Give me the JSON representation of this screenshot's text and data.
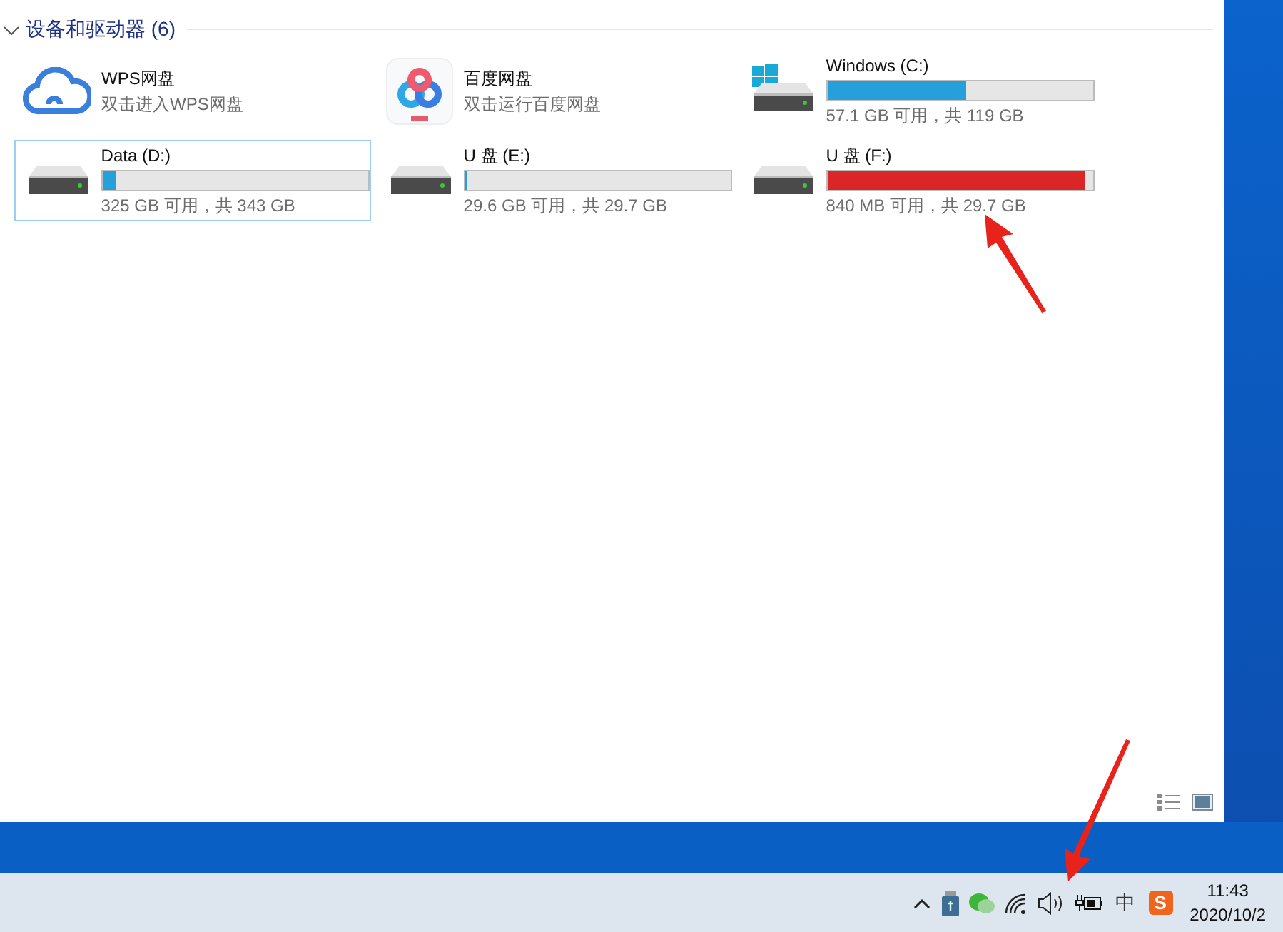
{
  "group": {
    "title": "设备和驱动器 (6)",
    "expanded": true
  },
  "items": [
    {
      "kind": "app",
      "name": "WPS网盘",
      "subtitle": "双击进入WPS网盘",
      "selected": false
    },
    {
      "kind": "app",
      "name": "百度网盘",
      "subtitle": "双击运行百度网盘",
      "selected": false
    },
    {
      "kind": "drive",
      "system": true,
      "name": "Windows (C:)",
      "level": 0.52,
      "low_space": false,
      "usage": "57.1 GB 可用，共 119 GB",
      "selected": false
    },
    {
      "kind": "drive",
      "system": false,
      "name": "Data (D:)",
      "level": 0.05,
      "low_space": false,
      "usage": "325 GB 可用，共 343 GB",
      "selected": true
    },
    {
      "kind": "drive",
      "system": false,
      "name": "U 盘 (E:)",
      "level": 0.003,
      "low_space": false,
      "usage": "29.6 GB 可用，共 29.7 GB",
      "selected": false
    },
    {
      "kind": "drive",
      "system": false,
      "name": "U 盘 (F:)",
      "level": 0.97,
      "low_space": true,
      "usage": "840 MB 可用，共 29.7 GB",
      "selected": false
    }
  ],
  "taskbar": {
    "ime": "中",
    "ime_app": "S",
    "time": "11:43",
    "date": "2020/10/2"
  }
}
